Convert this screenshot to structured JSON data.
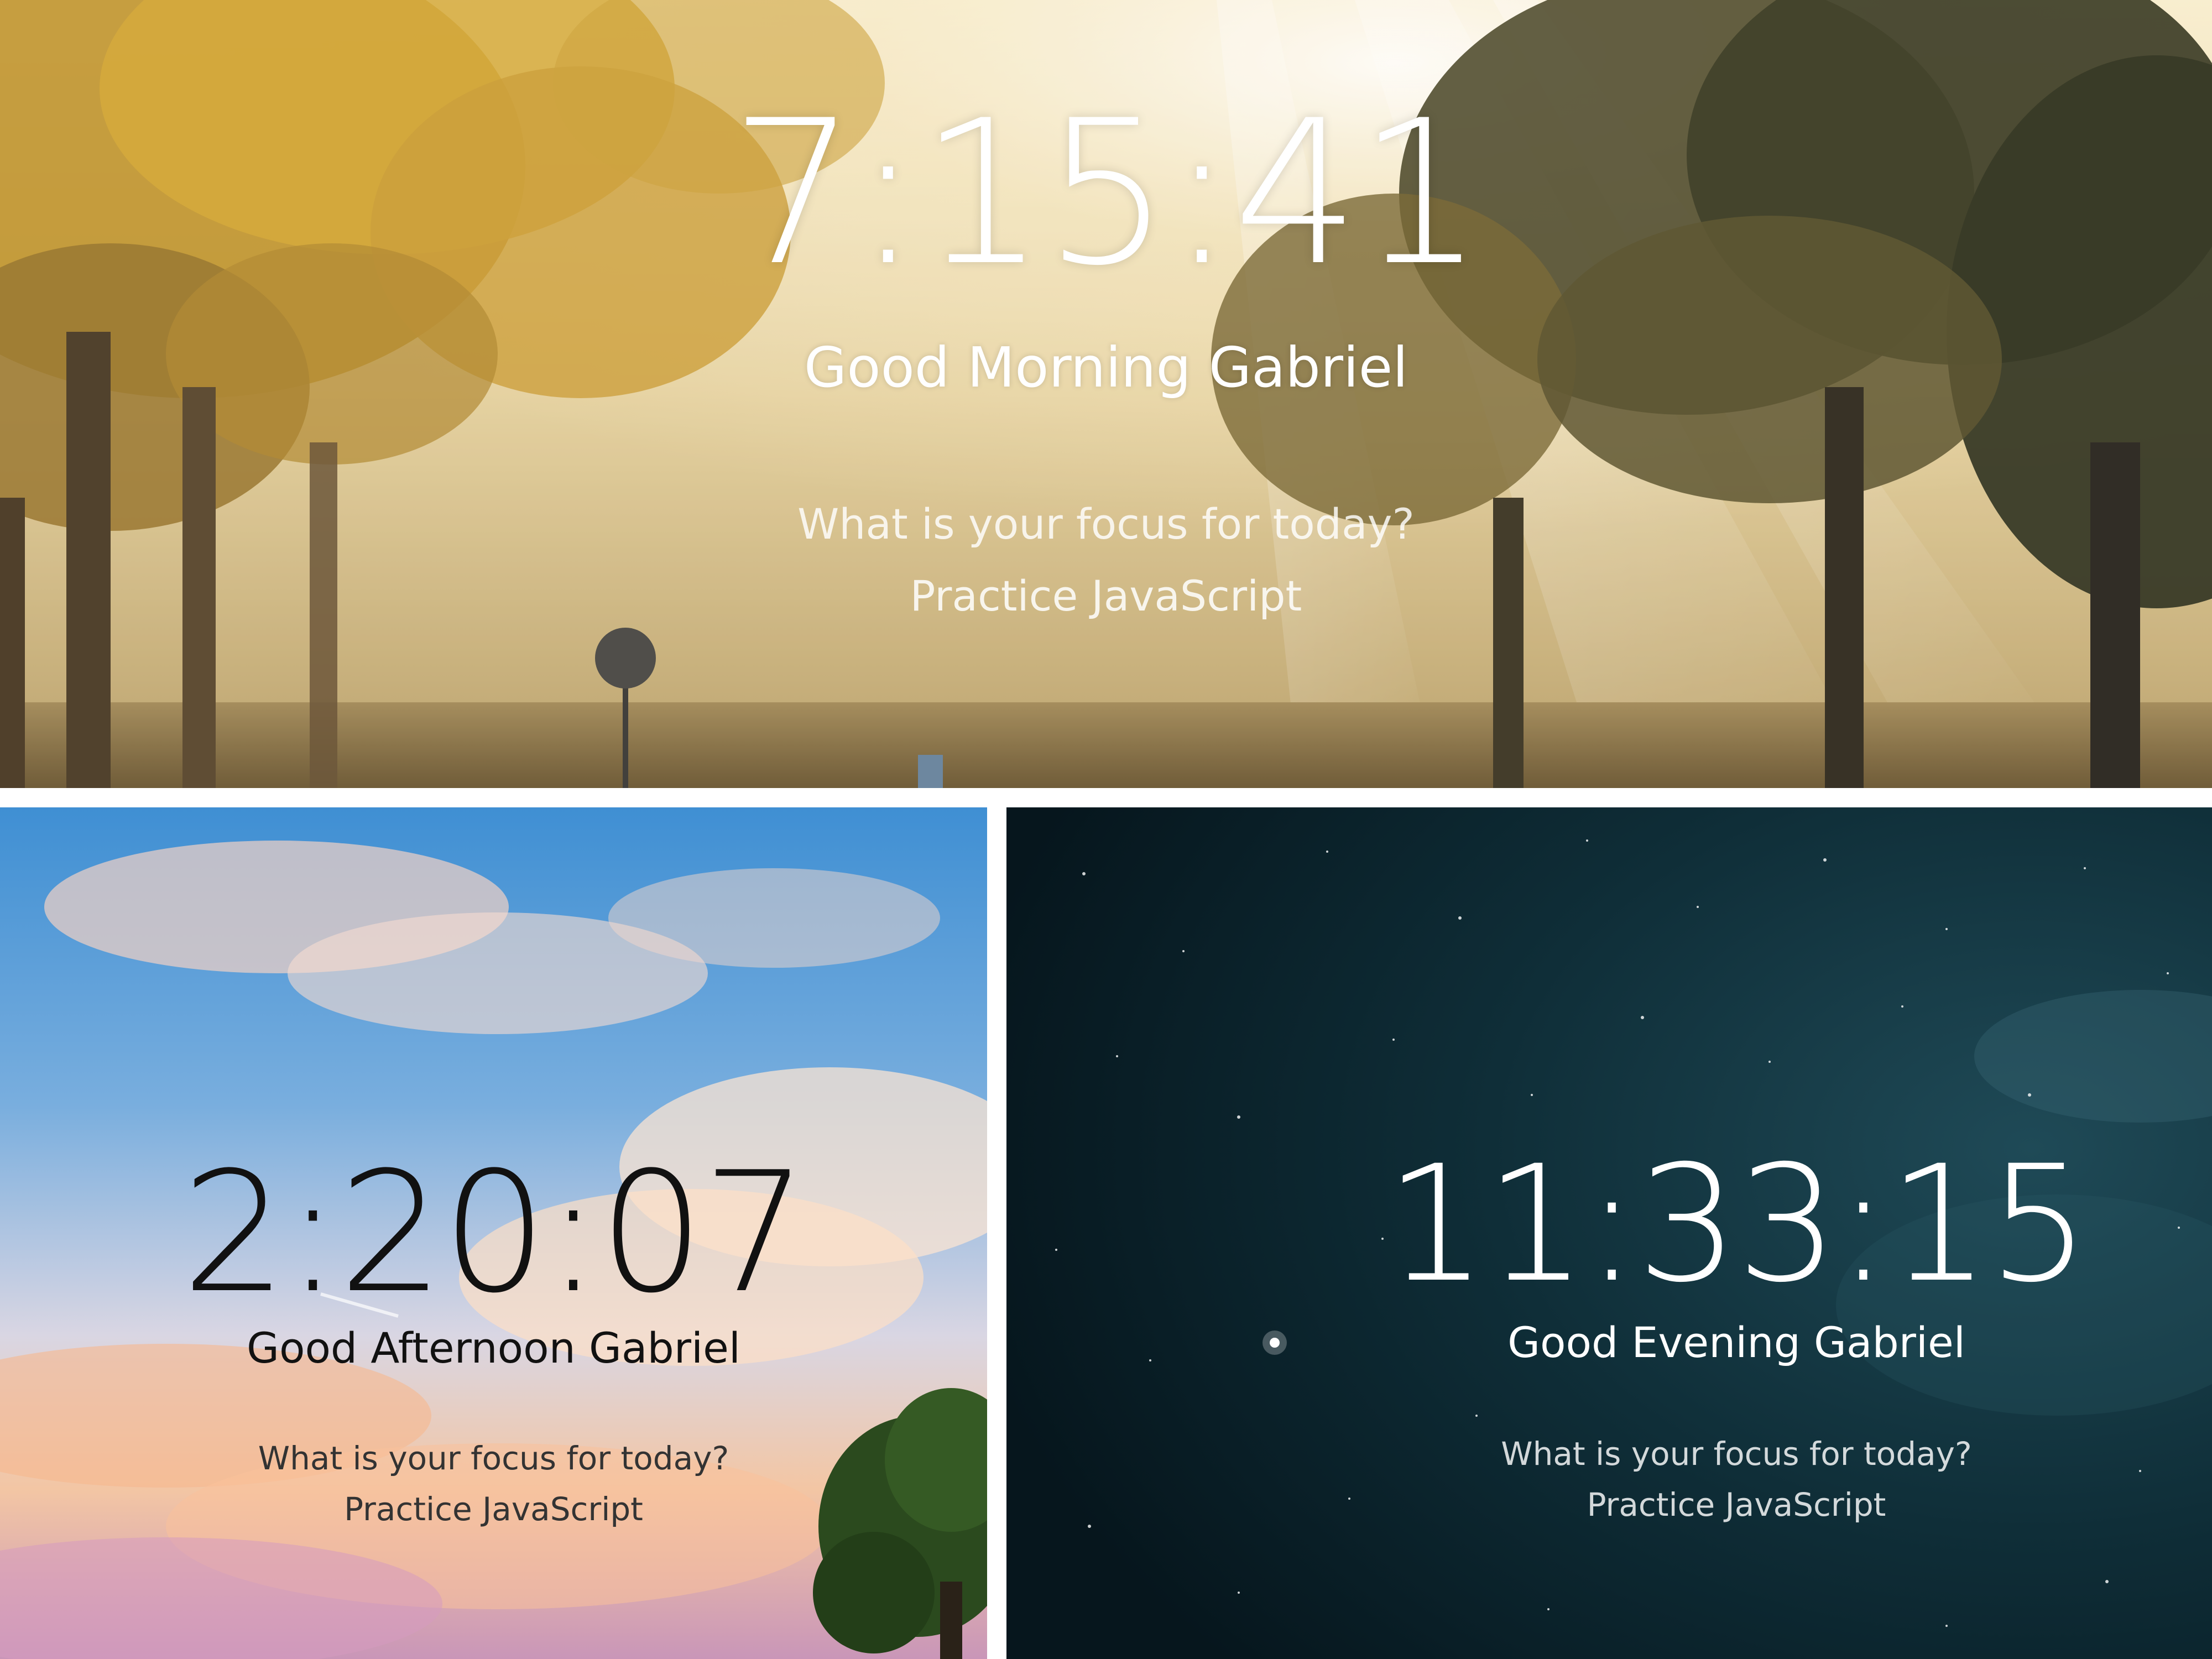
{
  "panels": {
    "morning": {
      "time": "7:15:41",
      "greeting": "Good Morning Gabriel",
      "focus_question": "What is your focus for today?",
      "focus_value": "Practice JavaScript",
      "text_color": "#ffffff"
    },
    "afternoon": {
      "time": "2:20:07",
      "greeting": "Good Afternoon Gabriel",
      "focus_question": "What is your focus for today?",
      "focus_value": "Practice JavaScript",
      "text_color": "#111111"
    },
    "evening": {
      "time": "11:33:15",
      "greeting": "Good Evening Gabriel",
      "focus_question": "What is your focus for today?",
      "focus_value": "Practice JavaScript",
      "text_color": "#ffffff"
    }
  },
  "colors": {
    "separator": "#ffffff",
    "morning_sky": "#f3e2b6",
    "afternoon_sky": "#4a93d6",
    "evening_sky": "#0d2a33"
  }
}
